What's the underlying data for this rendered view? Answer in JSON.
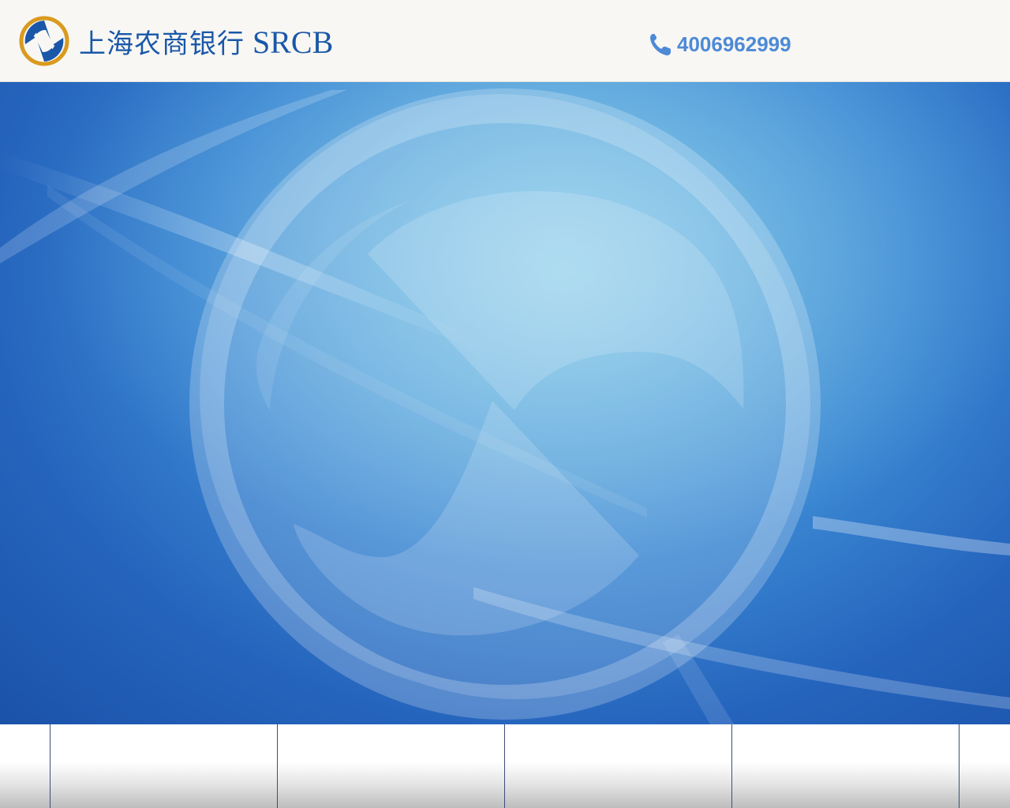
{
  "header": {
    "logo": {
      "name_cn": "上海农商银行",
      "name_en": "SRCB",
      "icon": "srcb-logo-icon"
    },
    "phone": {
      "icon": "phone-icon",
      "number": "4006962999"
    }
  },
  "banner": {
    "background": "srcb-logo-watermark",
    "colors": {
      "deep_blue": "#1b52a9",
      "light_blue": "#7cc4e6"
    }
  },
  "tiles": {
    "count": 4
  },
  "colors": {
    "brand_blue": "#1a57a8",
    "brand_gold": "#d99a1e",
    "phone_blue": "#4d8ad6",
    "header_bg": "#f8f7f4"
  }
}
